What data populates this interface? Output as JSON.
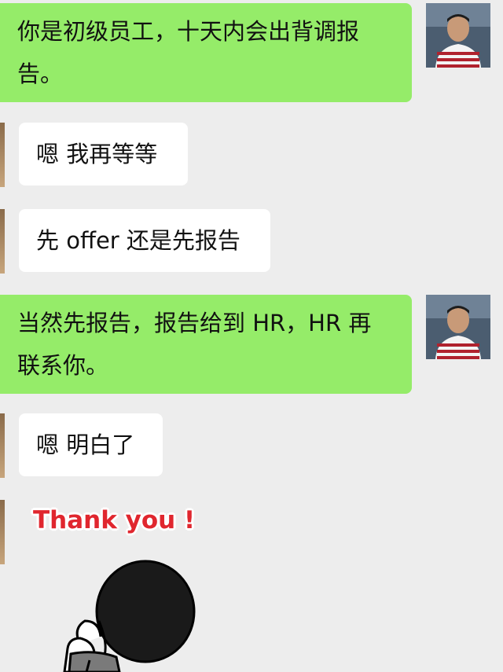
{
  "messages": [
    {
      "side": "out",
      "lines": [
        "你是初级员工，十天内会出背调报",
        "告。"
      ],
      "avatar": "avatar"
    },
    {
      "side": "in",
      "lines": [
        "嗯 我再等等"
      ]
    },
    {
      "side": "in",
      "lines": [
        "先 offer 还是先报告"
      ]
    },
    {
      "side": "out",
      "lines": [
        "当然先报告，报告给到 HR，HR 再",
        "联系你。"
      ],
      "avatar": "avatar"
    },
    {
      "side": "in",
      "lines": [
        "嗯 明白了"
      ]
    }
  ],
  "sticker": {
    "text": "Thank you !",
    "text_color": "#e0262e",
    "icon": "girl-bowing-sticker"
  },
  "colors": {
    "background": "#ededed",
    "outgoing_bubble": "#95ec69",
    "incoming_bubble": "#ffffff"
  }
}
